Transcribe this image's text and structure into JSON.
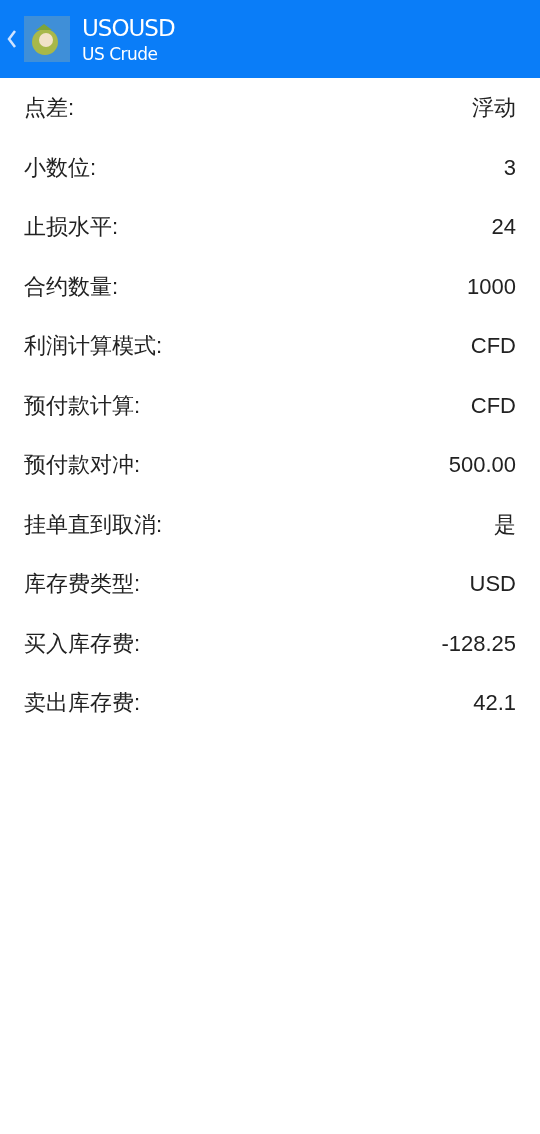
{
  "header": {
    "title": "USOUSD",
    "subtitle": "US Crude"
  },
  "rows": [
    {
      "label": "点差:",
      "value": "浮动"
    },
    {
      "label": "小数位:",
      "value": "3"
    },
    {
      "label": "止损水平:",
      "value": "24"
    },
    {
      "label": "合约数量:",
      "value": "1000"
    },
    {
      "label": "利润计算模式:",
      "value": "CFD"
    },
    {
      "label": "预付款计算:",
      "value": "CFD"
    },
    {
      "label": "预付款对冲:",
      "value": "500.00"
    },
    {
      "label": "挂单直到取消:",
      "value": "是"
    },
    {
      "label": "库存费类型:",
      "value": "USD"
    },
    {
      "label": "买入库存费:",
      "value": "-128.25"
    },
    {
      "label": "卖出库存费:",
      "value": "42.1"
    }
  ]
}
